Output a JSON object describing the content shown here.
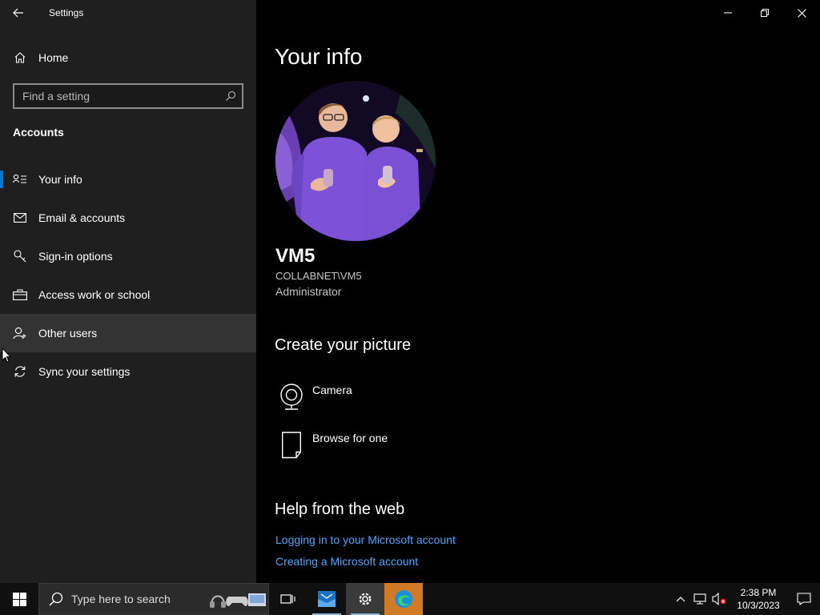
{
  "window": {
    "title": "Settings"
  },
  "sidebar": {
    "home_label": "Home",
    "search_placeholder": "Find a setting",
    "section_title": "Accounts",
    "items": [
      {
        "label": "Your info",
        "icon": "contact-card-icon"
      },
      {
        "label": "Email & accounts",
        "icon": "mail-icon"
      },
      {
        "label": "Sign-in options",
        "icon": "key-icon"
      },
      {
        "label": "Access work or school",
        "icon": "briefcase-icon"
      },
      {
        "label": "Other users",
        "icon": "add-person-icon"
      },
      {
        "label": "Sync your settings",
        "icon": "sync-icon"
      }
    ]
  },
  "main": {
    "title": "Your info",
    "user": {
      "name": "VM5",
      "account": "COLLABNET\\VM5",
      "role": "Administrator"
    },
    "create_picture": {
      "heading": "Create your picture",
      "options": [
        {
          "label": "Camera",
          "icon": "camera-icon"
        },
        {
          "label": "Browse for one",
          "icon": "document-icon"
        }
      ]
    },
    "help": {
      "heading": "Help from the web",
      "links": [
        "Logging in to your Microsoft account",
        "Creating a Microsoft account"
      ]
    }
  },
  "taskbar": {
    "search_text": "Type here to search",
    "time": "2:38 PM",
    "date": "10/3/2023"
  },
  "colors": {
    "accent": "#0078d7",
    "link": "#4ca6ff",
    "sidebar_bg": "#1f1f1f",
    "main_bg": "#000000",
    "edge_tile": "#d17a25"
  }
}
